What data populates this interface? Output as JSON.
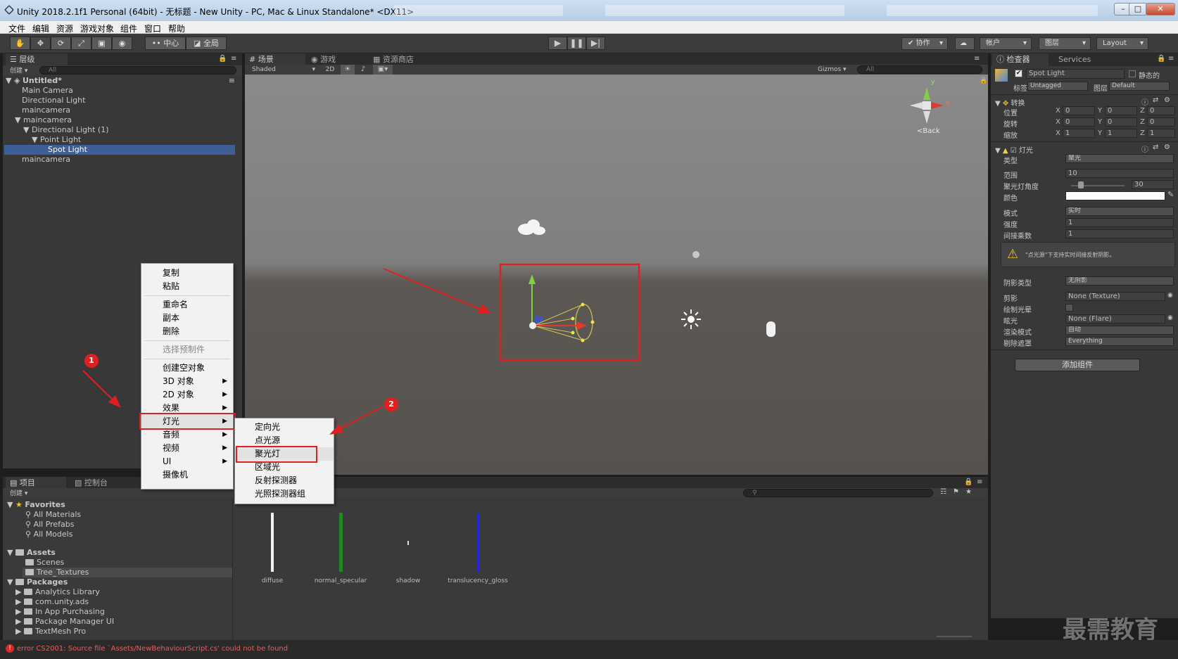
{
  "window": {
    "title": "Unity 2018.2.1f1 Personal (64bit) - 无标题 - New Unity - PC, Mac & Linux Standalone* <DX11>",
    "buttons": {
      "minimize": "–",
      "maximize": "□",
      "close": "✕"
    }
  },
  "menubar": [
    "文件",
    "编辑",
    "资源",
    "游戏对象",
    "组件",
    "窗口",
    "帮助"
  ],
  "toolbar": {
    "pivot": "中心",
    "global": "全局",
    "collab": "协作",
    "account": "帐户",
    "layers": "图层",
    "layout": "Layout"
  },
  "hierarchy": {
    "tab": "层级",
    "create": "创建",
    "search_placeholder": "All",
    "scene_name": "Untitled*",
    "items": [
      {
        "label": "Main Camera"
      },
      {
        "label": "Directional Light"
      },
      {
        "label": "maincamera"
      },
      {
        "label": "maincamera"
      },
      {
        "label": "Directional Light (1)"
      },
      {
        "label": "Point Light"
      },
      {
        "label": "Spot Light"
      },
      {
        "label": "maincamera"
      }
    ]
  },
  "scene_view": {
    "tabs": [
      "场景",
      "游戏",
      "资源商店"
    ],
    "shading": "Shaded",
    "mode_2d": "2D",
    "gizmos": "Gizmos",
    "search_placeholder": "All",
    "gizmo_back": "Back",
    "gizmo_axes": {
      "x": "x",
      "y": "y"
    }
  },
  "context_menu": {
    "items": [
      {
        "label": "复制",
        "enabled": true
      },
      {
        "label": "粘贴",
        "enabled": true
      },
      {
        "label": "重命名",
        "enabled": true
      },
      {
        "label": "副本",
        "enabled": true
      },
      {
        "label": "删除",
        "enabled": true
      },
      {
        "label": "选择预制件",
        "enabled": false
      },
      {
        "label": "创建空对象",
        "enabled": true
      },
      {
        "label": "3D 对象",
        "submenu": true
      },
      {
        "label": "2D 对象",
        "submenu": true
      },
      {
        "label": "效果",
        "submenu": true
      },
      {
        "label": "灯光",
        "submenu": true,
        "highlighted": true
      },
      {
        "label": "音频",
        "submenu": true
      },
      {
        "label": "视频",
        "submenu": true
      },
      {
        "label": "UI",
        "submenu": true
      },
      {
        "label": "摄像机"
      }
    ],
    "light_submenu": [
      "定向光",
      "点光源",
      "聚光灯",
      "区域光",
      "反射探测器",
      "光照探测器组"
    ]
  },
  "annotations": {
    "badge1": "1",
    "badge2": "2"
  },
  "inspector": {
    "tabs": [
      "检查器",
      "Services"
    ],
    "object_name": "Spot Light",
    "static_label": "静态的",
    "tag_label": "标签",
    "tag_value": "Untagged",
    "layer_label": "图层",
    "layer_value": "Default",
    "transform": {
      "title": "转换",
      "rows": [
        {
          "label": "位置",
          "x": "0",
          "y": "0",
          "z": "0"
        },
        {
          "label": "旋转",
          "x": "0",
          "y": "0",
          "z": "0"
        },
        {
          "label": "缩放",
          "x": "1",
          "y": "1",
          "z": "1"
        }
      ]
    },
    "light": {
      "title": "灯光",
      "type_label": "类型",
      "type_value": "聚光",
      "range_label": "范围",
      "range_value": "10",
      "angle_label": "聚光灯角度",
      "angle_value": "30",
      "color_label": "颜色",
      "color_hex": "#ffffff",
      "mode_label": "模式",
      "mode_value": "实时",
      "intensity_label": "强度",
      "intensity_value": "1",
      "indirect_label": "间接乘数",
      "indirect_value": "1",
      "warning": "\"点光源\"下支持实时间接反射阴影。",
      "shadow_label": "阴影类型",
      "shadow_value": "无阴影",
      "cookie_label": "剪影",
      "cookie_value": "None (Texture)",
      "halo_label": "绘制光晕",
      "flare_label": "眩光",
      "flare_value": "None (Flare)",
      "render_label": "渲染模式",
      "render_value": "自动",
      "culling_label": "剔除遮罩",
      "culling_value": "Everything"
    },
    "add_component": "添加组件"
  },
  "project": {
    "tabs": [
      "项目",
      "控制台"
    ],
    "create": "创建",
    "favorites_label": "Favorites",
    "favorites": [
      "All Materials",
      "All Prefabs",
      "All Models"
    ],
    "assets_label": "Assets",
    "assets": [
      "Scenes",
      "Tree_Textures"
    ],
    "packages_label": "Packages",
    "packages": [
      "Analytics Library",
      "com.unity.ads",
      "In App Purchasing",
      "Package Manager UI",
      "TextMesh Pro"
    ],
    "files": [
      {
        "name": "diffuse",
        "color": "#f2f2f2"
      },
      {
        "name": "normal_specular",
        "color": "#1f8a1f"
      },
      {
        "name": "shadow",
        "color": "#dddddd"
      },
      {
        "name": "translucency_gloss",
        "color": "#2727d8"
      }
    ]
  },
  "status": {
    "error": "error CS2001: Source file `Assets/NewBehaviourScript.cs' could not be found"
  },
  "watermark": "最需教育",
  "colors": {
    "accent_red": "#e02020",
    "selection": "#3e5f96"
  }
}
